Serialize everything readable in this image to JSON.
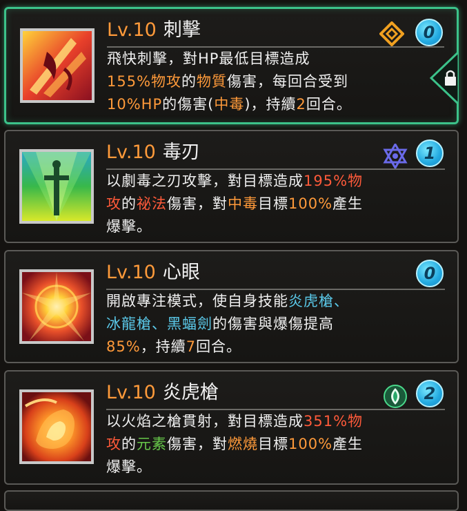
{
  "skills": [
    {
      "level": "Lv.10",
      "name": "刺擊",
      "cooldown": "0",
      "type_icon": "diamond-ring-icon",
      "selected": true,
      "locked": true,
      "desc": {
        "l1": "飛快刺擊，對HP最低目標造成",
        "l2a": "155%物攻",
        "l2b": "的",
        "l2c": "物質",
        "l2d": "傷害，每回合受到",
        "l3a": "10%HP",
        "l3b": "的傷害(",
        "l3c": "中毒",
        "l3d": ")，持續",
        "l3e": "2",
        "l3f": "回合。"
      }
    },
    {
      "level": "Lv.10",
      "name": "毒刃",
      "cooldown": "1",
      "type_icon": "hexagram-star-icon",
      "desc": {
        "l1a": "以劇毒之刃攻擊，對目標造成",
        "l1b": "195%物",
        "l2a": "攻",
        "l2b": "的",
        "l2c": "祕法",
        "l2d": "傷害，對",
        "l2e": "中毒",
        "l2f": "目標",
        "l2g": "100%",
        "l2h": "產生",
        "l3": "爆擊。"
      }
    },
    {
      "level": "Lv.10",
      "name": "心眼",
      "cooldown": "0",
      "desc": {
        "l1a": "開啟專注模式，使自身技能",
        "l1b": "炎虎槍、",
        "l2a": "冰龍槍、黑蝠劍",
        "l2b": "的傷害與爆傷提高",
        "l3a": "85%",
        "l3b": "，持續",
        "l3c": "7",
        "l3d": "回合。"
      }
    },
    {
      "level": "Lv.10",
      "name": "炎虎槍",
      "cooldown": "2",
      "type_icon": "green-leaf-orb-icon",
      "desc": {
        "l1a": "以火焰之槍貫射，對目標造成",
        "l1b": "351%物",
        "l2a": "攻",
        "l2b": "的",
        "l2c": "元素",
        "l2d": "傷害，對",
        "l2e": "燃燒",
        "l2f": "目標",
        "l2g": "100%",
        "l2h": "產生",
        "l3": "爆擊。"
      }
    }
  ],
  "colors": {
    "highlight_orange": "#ff9a3a",
    "highlight_red": "#ff5a3a",
    "highlight_blue": "#5ac8e8",
    "highlight_green": "#67c84a",
    "selected_border": "#3cc28a",
    "cooldown_badge": "#22a9e0"
  }
}
